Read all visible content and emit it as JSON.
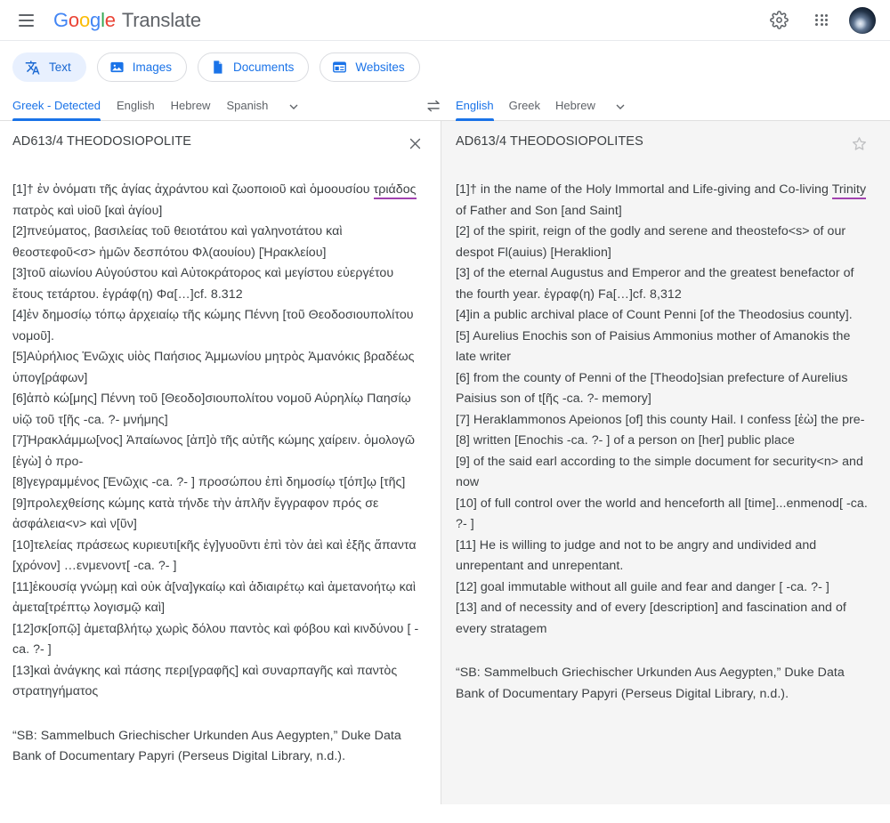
{
  "appbar": {
    "menu_label": "Main menu",
    "brand_google": [
      "G",
      "o",
      "o",
      "g",
      "l",
      "e"
    ],
    "brand_product": "Translate",
    "settings_label": "Settings",
    "apps_label": "Google apps",
    "account_label": "Google Account"
  },
  "modes": [
    {
      "id": "text",
      "label": "Text",
      "icon": "translate-icon",
      "active": true
    },
    {
      "id": "images",
      "label": "Images",
      "icon": "image-icon",
      "active": false
    },
    {
      "id": "documents",
      "label": "Documents",
      "icon": "document-icon",
      "active": false
    },
    {
      "id": "websites",
      "label": "Websites",
      "icon": "website-icon",
      "active": false
    }
  ],
  "source_langs": {
    "options": [
      "Greek - Detected",
      "English",
      "Hebrew",
      "Spanish"
    ],
    "selected": "Greek - Detected",
    "more_icon": "chevron-down-icon"
  },
  "swap": {
    "icon": "swap-horizontal-icon",
    "label": "Swap languages"
  },
  "target_langs": {
    "options": [
      "English",
      "Greek",
      "Hebrew"
    ],
    "selected": "English",
    "more_icon": "chevron-down-icon"
  },
  "source_panel": {
    "title": "AD613/4 THEODOSIOPOLITE",
    "clear_icon": "close-icon",
    "text_before_hl": "[1]† ἐν ὀνόματι τῆς ἁγίας ἀχράντου καὶ ζωοποιοῦ καὶ ὁμοουσίου ",
    "highlight": "τριάδος",
    "text_after_hl": " πατρὸς καὶ υἱοῦ [καὶ ἁγίου]\n[2]πνεύματος, βασιλείας τοῦ θειοτάτου καὶ γαληνοτάτου καὶ θεοστεφοῦ<σ> ἡμῶν δεσπότου Φλ(αουίου) [Ἡρακλείου]\n[3]τοῦ αἰωνίου Αὐγούστου καὶ Αὐτοκράτορος καὶ μεγίστου εὐεργέτου ἔτους τετάρτου. ἐγράφ(η) Φα[…]cf. 8.312\n[4]ἐν δημοσίῳ τόπῳ ἀρχειαίῳ τῆς κώμης Πέννη [τοῦ Θεοδοσιουπολίτου νομοῦ].\n[5]Αὐρήλιος Ἑνῶχις υἱὸς Παήσιος Ἀμμωνίου μητρὸς Ἀμανόκις βραδέως ὑπογ[ράφων]\n[6]ἀπὸ κώ[μης] Πέννη τοῦ [Θεοδο]σιουπολίτου νομοῦ Αὐρηλίῳ Παησίῳ υἱῷ τοῦ τ[ῆς -ca. ?- μνήμης]\n[7]Ἡρακλάμμω[νος] Ἀπαίωνος [ἀπ]ὸ τῆς αὐτῆς κώμης χαίρειν. ὁμολογῶ [ἐγὼ] ὁ προ-\n[8]γεγραμμένος [Ἑνῶχις -ca. ?- ] προσώπου ἐπὶ δημοσίῳ τ[όπ]ῳ [τῆς]\n[9]προλεχθείσης κώμης κατὰ τήνδε τὴν ἁπλῆν ἔγγραφον πρός σε ἀσφάλεια<ν> καὶ ν[ῦν]\n[10]τελείας πράσεως κυριευτι[κῆς ἐγ]γυοῦντι ἐπὶ τὸν ἀεὶ καὶ ἑξῆς ἅπαντα [χρόνον] …ενμενοντ[ -ca. ?- ]\n[11]ἑκουσίᾳ γνώμῃ καὶ οὐκ ἀ[να]γκαίῳ καὶ ἀδιαιρέτῳ καὶ ἀμετανοήτῳ καὶ ἀμετα[τρέπτῳ λογισμῷ καὶ]\n[12]σκ[οπῷ] ἀμεταβλήτῳ χωρὶς δόλου παντὸς καὶ φόβου καὶ κινδύνου [ -ca. ?- ]\n[13]καὶ ἀνάγκης καὶ πάσης περι[γραφῆς] καὶ συναρπαγῆς καὶ παντὸς στρατηγήματος",
    "citation": "“SB: Sammelbuch Griechischer Urkunden Aus Aegypten,” Duke Data Bank of Documentary Papyri (Perseus Digital Library, n.d.)."
  },
  "target_panel": {
    "title": "AD613/4 THEODOSIOPOLITES",
    "save_icon": "star-icon",
    "text_before_hl": "[1]† in the name of the Holy Immortal and Life-giving and Co-living ",
    "highlight": "Trinity",
    "text_after_hl": " of Father and Son [and Saint]\n[2] of the spirit, reign of the godly and serene and theostefo<s> of our despot Fl(auius) [Heraklion]\n[3] of the eternal Augustus and Emperor and the greatest benefactor of the fourth year. ἐγραφ(η) Fa[…]cf. 8,312\n[4]in a public archival place of Count Penni [of the Theodosius county].\n[5] Aurelius Enochis son of Paisius Ammonius mother of Amanokis the late writer\n[6] from the county of Penni of the [Theodo]sian prefecture of Aurelius Paisius son of t[ῆς -ca. ?- memory]\n[7] Heraklammonos Apeionos [of] this county Hail. I confess [ἐὼ] the pre-\n[8] written [Enochis -ca. ?- ] of a person on [her] public place\n[9] of the said earl according to the simple document for security<n> and now\n[10] of full control over the world and henceforth all [time]...enmenod[ -ca. ?- ]\n[11] He is willing to judge and not to be angry and undivided and unrepentant and unrepentant.\n[12] goal immutable without all guile and fear and danger [ -ca. ?- ]\n[13] and of necessity and of every [description] and fascination and of every stratagem",
    "citation": "“SB: Sammelbuch Griechischer Urkunden Aus Aegypten,” Duke Data Bank of Documentary Papyri (Perseus Digital Library, n.d.)."
  },
  "colors": {
    "accent_blue": "#1a73e8",
    "chip_active_bg": "#e8f0fe",
    "highlight_purple": "#a142b0",
    "target_panel_bg": "#f5f5f5"
  }
}
